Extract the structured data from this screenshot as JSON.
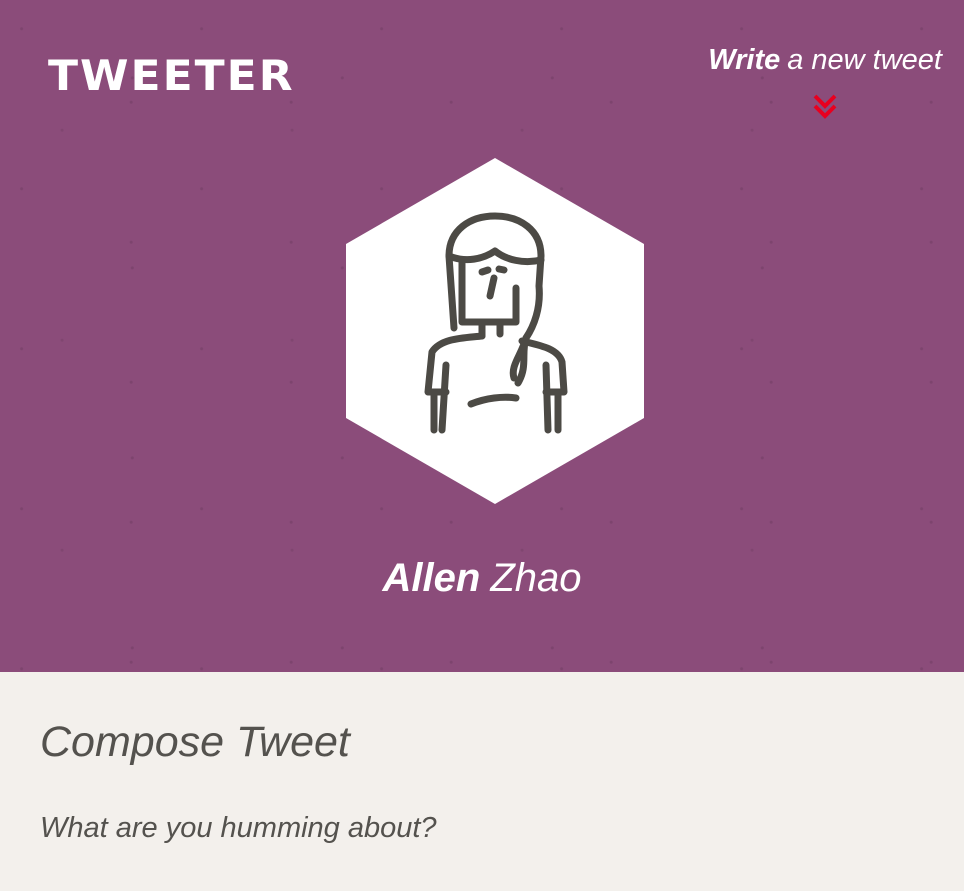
{
  "brand": {
    "logo_text": "TWEETER"
  },
  "nav": {
    "write_bold": "Write",
    "write_rest": "a new tweet",
    "chevron_icon": "double-chevron-down-icon",
    "chevron_color": "#e8001f"
  },
  "profile": {
    "first_name": "Allen",
    "last_name": "Zhao",
    "avatar_icon": "user-avatar-icon"
  },
  "compose": {
    "title": "Compose Tweet",
    "prompt": "What are you humming about?"
  },
  "colors": {
    "header_bg": "#8b4c7a",
    "page_bg": "#f3f0ec",
    "text_dark": "#54524e",
    "text_light": "#ffffff"
  }
}
